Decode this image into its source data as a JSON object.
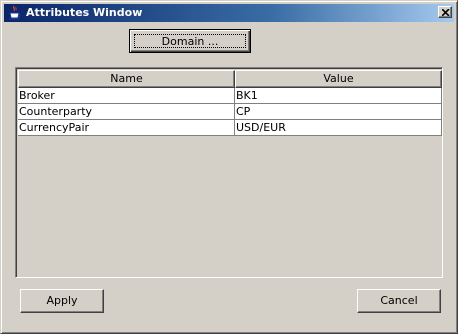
{
  "window": {
    "title": "Attributes Window",
    "icon": "java-cup-icon"
  },
  "toolbar": {
    "domain_label": "Domain ..."
  },
  "table": {
    "columns": [
      "Name",
      "Value"
    ],
    "rows": [
      {
        "name": "Broker",
        "value": "BK1"
      },
      {
        "name": "Counterparty",
        "value": "CP"
      },
      {
        "name": "CurrencyPair",
        "value": "USD/EUR"
      }
    ]
  },
  "footer": {
    "apply_label": "Apply",
    "cancel_label": "Cancel"
  },
  "colors": {
    "titlebar_start": "#0a246a",
    "titlebar_end": "#a6caf0",
    "face": "#d4d0c8"
  }
}
